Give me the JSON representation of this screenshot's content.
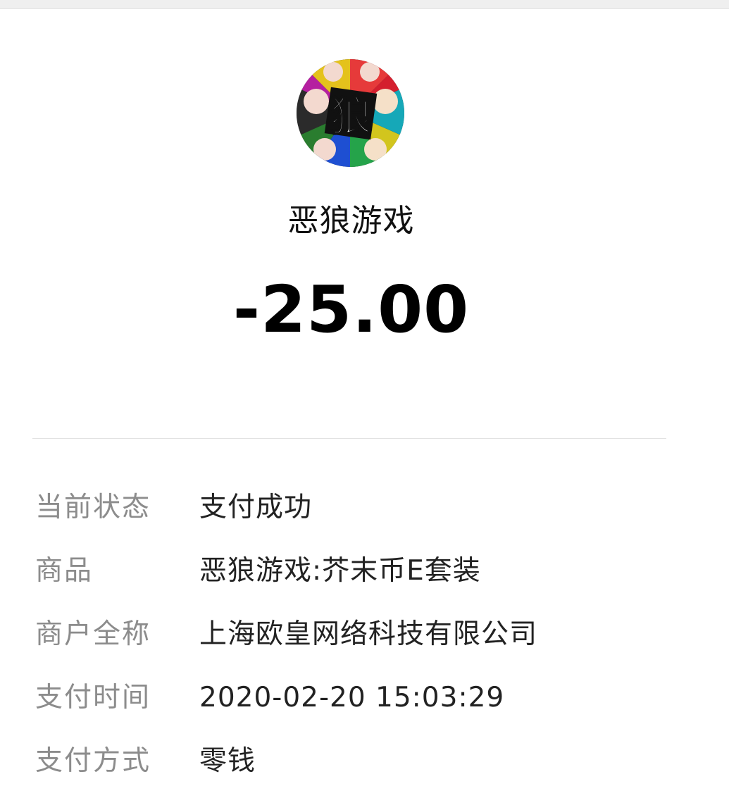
{
  "merchant": {
    "avatar_icon": "wolf-game-logo-icon",
    "avatar_character": "狼",
    "name": "恶狼游戏"
  },
  "amount": "-25.00",
  "details": [
    {
      "label": "当前状态",
      "value": "支付成功"
    },
    {
      "label": "商品",
      "value": "恶狼游戏:芥末币E套装"
    },
    {
      "label": "商户全称",
      "value": "上海欧皇网络科技有限公司"
    },
    {
      "label": "支付时间",
      "value": "2020-02-20 15:03:29"
    },
    {
      "label": "支付方式",
      "value": "零钱"
    }
  ],
  "colors": {
    "label": "#8c8c8c",
    "value": "#222222",
    "divider": "#e2e2e2"
  }
}
